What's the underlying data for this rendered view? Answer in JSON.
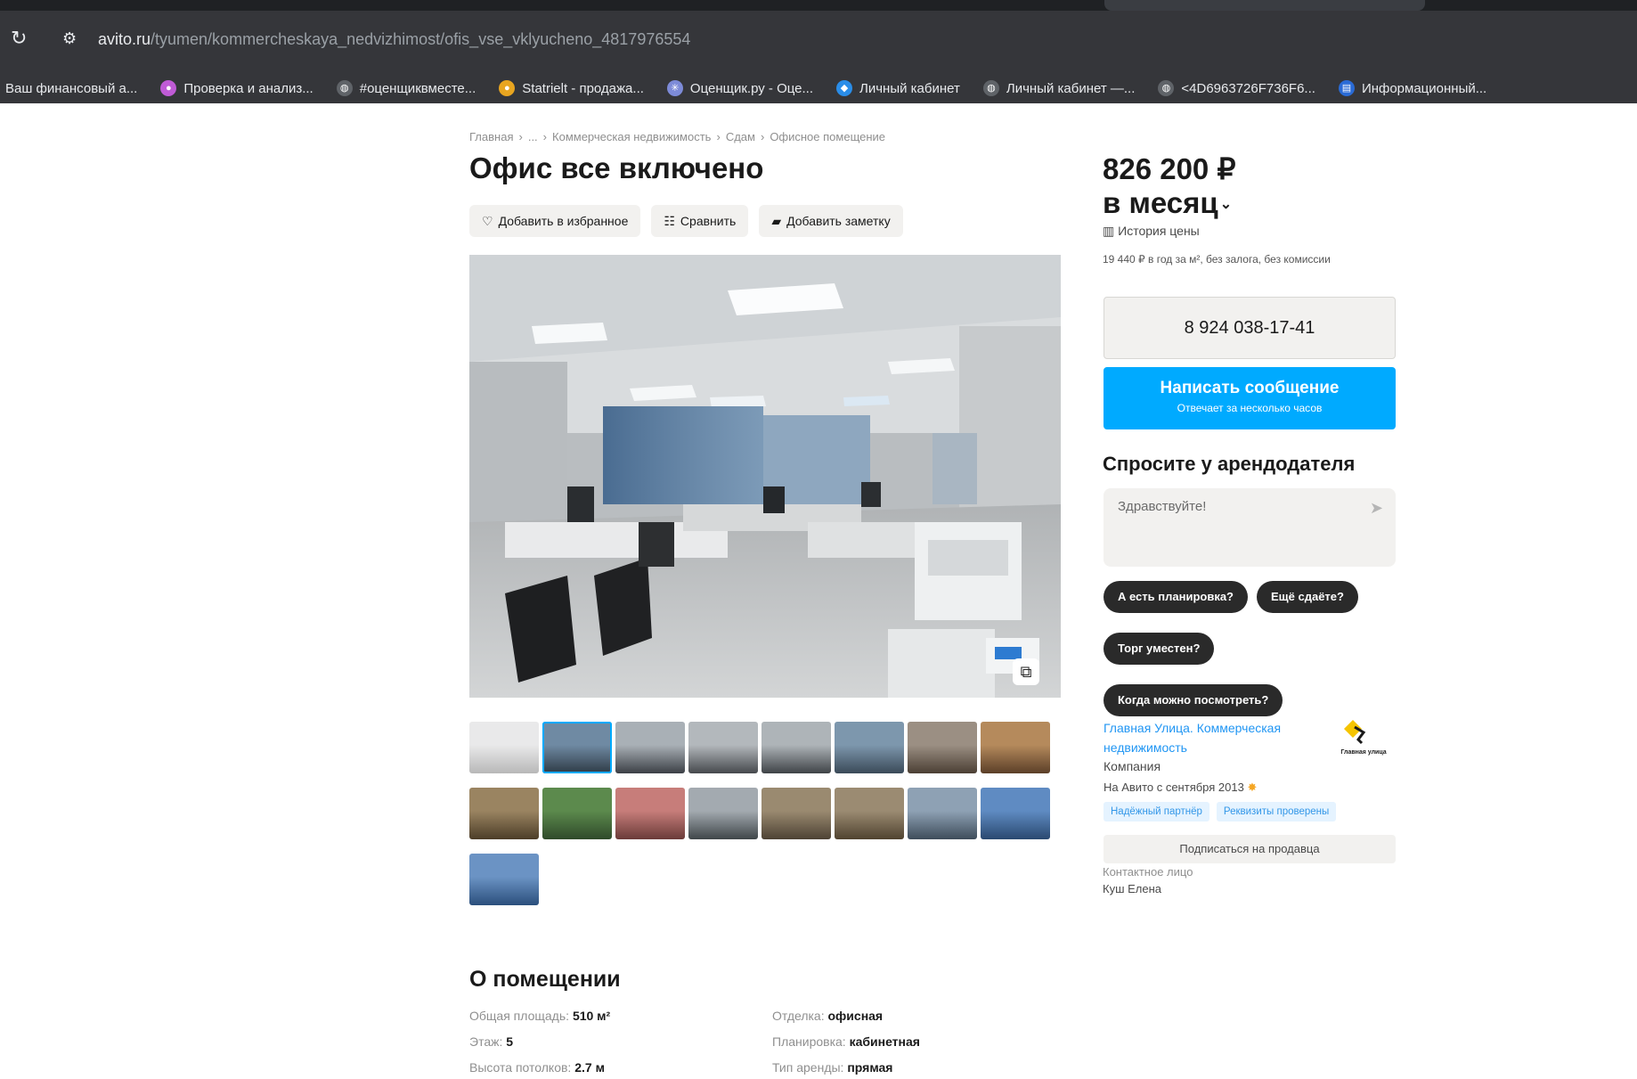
{
  "browser": {
    "url_host": "avito.ru",
    "url_path": "/tyumen/kommercheskaya_nedvizhimost/ofis_vse_vklyucheno_4817976554",
    "bookmarks": [
      {
        "label": "Ваш финансовый а...",
        "icon": "none",
        "color": ""
      },
      {
        "label": "Проверка и анализ...",
        "icon": "circle-icon",
        "color": "#c05bd6"
      },
      {
        "label": "#оценщиквместе...",
        "icon": "globe-icon",
        "color": "#5f6368"
      },
      {
        "label": "Statrielt - продажа...",
        "icon": "circle-icon",
        "color": "#e8a520"
      },
      {
        "label": "Оценщик.ру - Оце...",
        "icon": "star-icon",
        "color": "#7d8bd8"
      },
      {
        "label": "Личный кабинет",
        "icon": "shield-icon",
        "color": "#2a8de8"
      },
      {
        "label": "Личный кабинет —...",
        "icon": "globe-icon",
        "color": "#5f6368"
      },
      {
        "label": "<4D6963726F736F6...",
        "icon": "globe-icon",
        "color": "#5f6368"
      },
      {
        "label": "Информационный...",
        "icon": "doc-icon",
        "color": "#2a6bd6"
      }
    ]
  },
  "breadcrumb": [
    "Главная",
    "...",
    "Коммерческая недвижимость",
    "Сдам",
    "Офисное помещение"
  ],
  "title": "Офис все включено",
  "actions": {
    "favorite": "Добавить в избранное",
    "compare": "Сравнить",
    "note": "Добавить заметку"
  },
  "photos": {
    "thumb_count": 17,
    "active_index": 1
  },
  "about": {
    "title": "О помещении",
    "params": [
      {
        "key": "Общая площадь:",
        "value": "510 м²"
      },
      {
        "key": "Отделка:",
        "value": "офисная"
      },
      {
        "key": "Этаж:",
        "value": "5"
      },
      {
        "key": "Планировка:",
        "value": "кабинетная"
      },
      {
        "key": "Высота потолков:",
        "value": "2.7 м"
      },
      {
        "key": "Тип аренды:",
        "value": "прямая"
      }
    ]
  },
  "price": {
    "amount": "826 200 ₽",
    "period": "в месяц",
    "history": "История цены",
    "terms": "19 440 ₽ в год за м², без залога, без комиссии"
  },
  "contact": {
    "phone": "8 924 038-17-41",
    "message_label": "Написать сообщение",
    "message_sub": "Отвечает за несколько часов"
  },
  "ask": {
    "title": "Спросите у арендодателя",
    "placeholder": "Здравствуйте!",
    "chips": [
      "А есть планировка?",
      "Ещё сдаёте?",
      "Торг уместен?",
      "Когда можно посмотреть?"
    ]
  },
  "seller": {
    "name": "Главная Улица. Коммерческая недвижимость",
    "type": "Компания",
    "since": "На Авито с сентября 2013",
    "badges": [
      "Надёжный партнёр",
      "Реквизиты проверены"
    ],
    "subscribe": "Подписаться на продавца",
    "contact_label": "Контактное лицо",
    "contact_name": "Куш Елена",
    "logo_text": "Главная улица"
  }
}
